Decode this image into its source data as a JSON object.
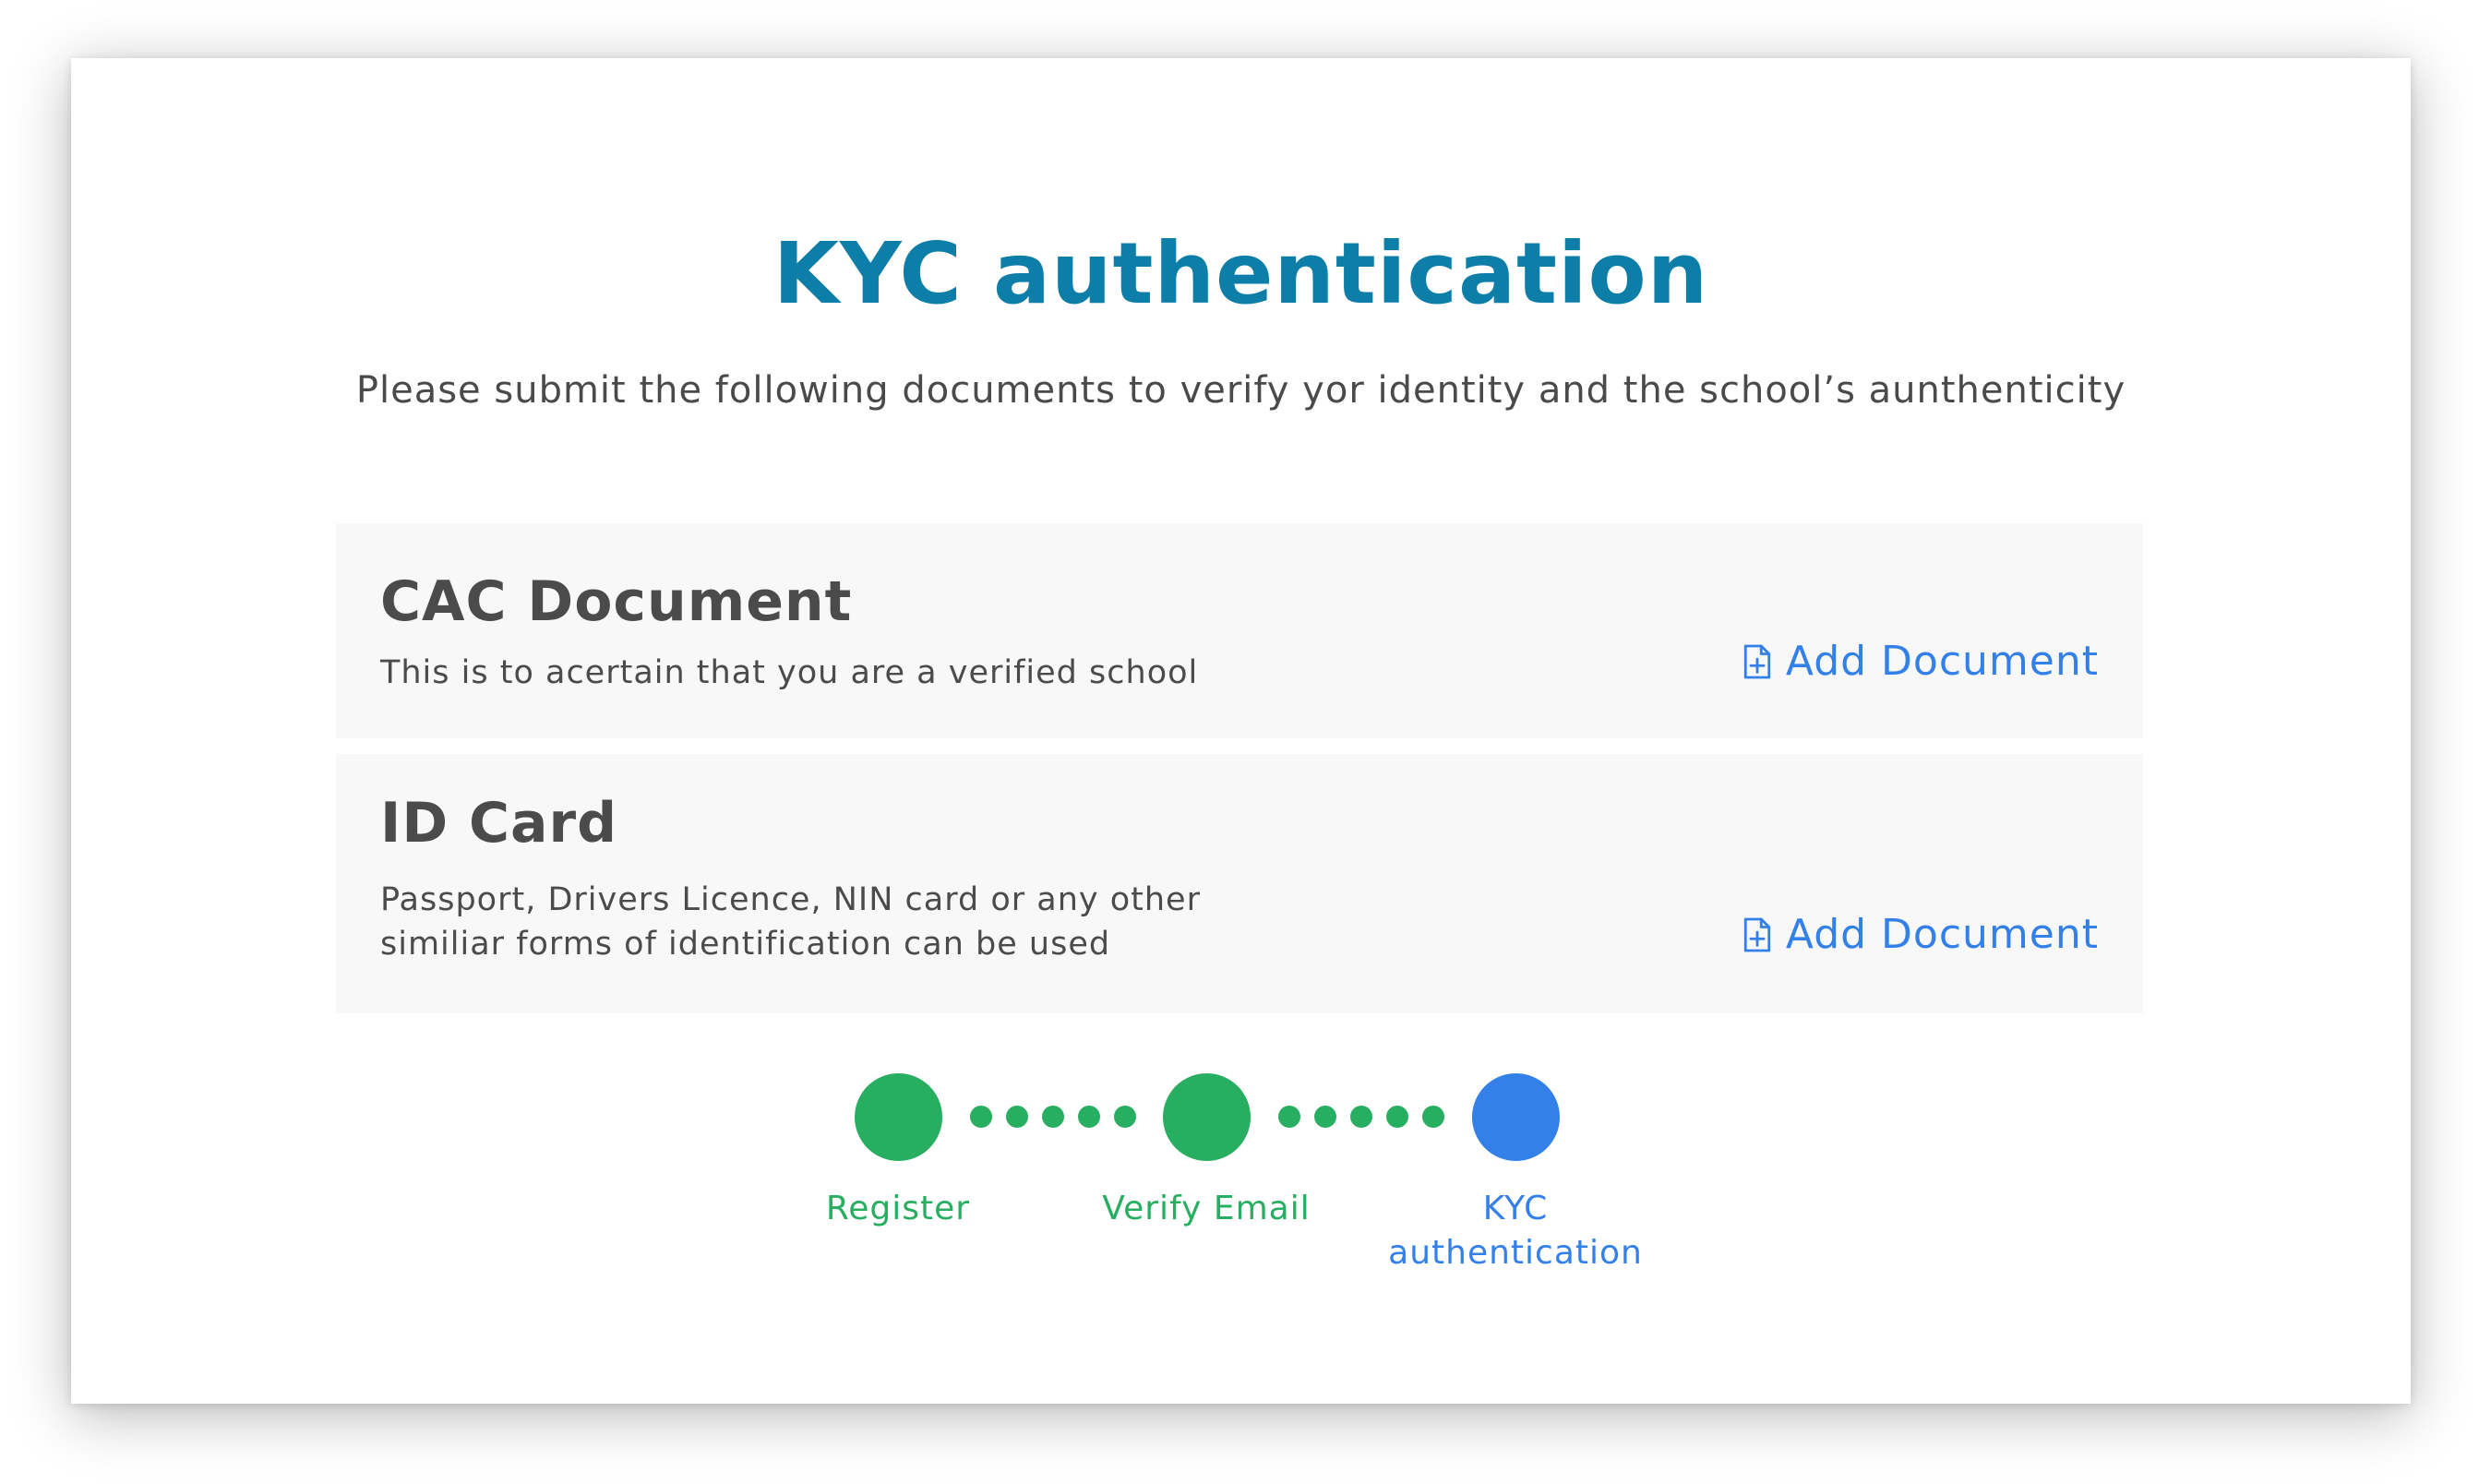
{
  "page": {
    "title": "KYC authentication",
    "subtitle": "Please submit the following documents to verify yor identity and the school’s aunthenticity"
  },
  "documents": [
    {
      "title": "CAC Document",
      "description": "This is to acertain that you are a verified school",
      "action_label": "Add Document",
      "action_icon": "file-plus-icon"
    },
    {
      "title": "ID Card",
      "description": "Passport, Drivers Licence, NIN card or any other\nsimiliar forms  of identification can be used",
      "action_label": "Add Document",
      "action_icon": "file-plus-icon"
    }
  ],
  "steps": [
    {
      "label": "Register",
      "status": "completed"
    },
    {
      "label": "Verify Email",
      "status": "completed"
    },
    {
      "label": "KYC\nauthentication",
      "status": "current"
    }
  ],
  "colors": {
    "title": "#0d7ea8",
    "text": "#4b4b4b",
    "accent_blue": "#3380e8",
    "completed_green": "#27ae60",
    "panel_bg": "#f8f8f8"
  }
}
